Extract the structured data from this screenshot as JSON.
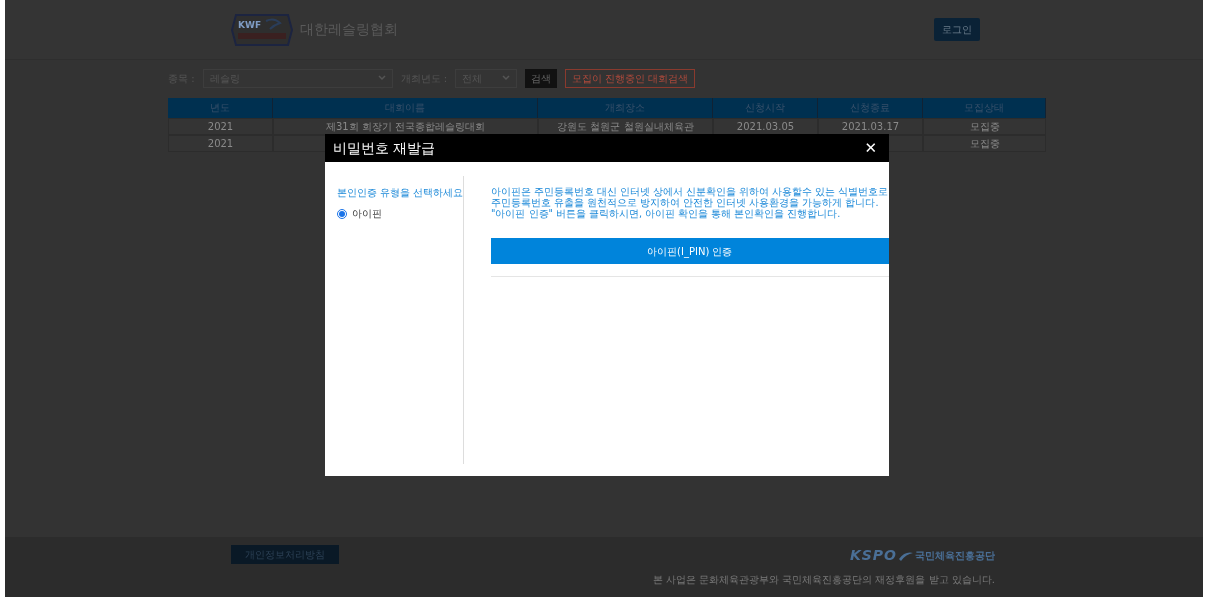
{
  "header": {
    "logo_text": "KWF",
    "site_title": "대한레슬링협회",
    "login_button": "로그인"
  },
  "filters": [
    {
      "label": "종목 :",
      "value": "레슬링",
      "kind": "wide"
    },
    {
      "label": "개최년도 :",
      "value": "전체",
      "kind": "narrow"
    }
  ],
  "search_button": "검색",
  "recruiting_search_button": "모집이 진행중인 대회검색",
  "table": {
    "columns": [
      "년도",
      "대회이름",
      "개최장소",
      "신청시작",
      "신청종료",
      "모집상태"
    ],
    "rows": [
      [
        "2021",
        "제31회 회장기 전국종합레슬링대회",
        "강원도 철원군 철원실내체육관",
        "2021.03.05",
        "2021.03.17",
        "모집중"
      ],
      [
        "2021",
        "",
        "",
        "",
        "",
        "모집중"
      ]
    ]
  },
  "modal": {
    "title": "비밀번호 재발급",
    "close": "✕",
    "prompt": "본인인증 유형을 선택하세요",
    "options": [
      {
        "label": "아이핀",
        "selected": true
      }
    ],
    "description": [
      "아이핀은 주민등록번호 대신 인터넷 상에서 신분확인을 위하여 사용할수 있는 식별번호로",
      "주민등록번호 유출을 원천적으로 방지하여 안전한 인터넷 사용환경을 가능하게 합니다.",
      "\"아이핀 인증\" 버튼을 클릭하시면, 아이핀 확인을 통해 본인확인을 진행합니다."
    ],
    "auth_button": "아이핀(I_PIN) 인증"
  },
  "footer": {
    "privacy_button": "개인정보처리방침",
    "logo_text": "KSPO",
    "logo_name": "국민체육진흥공단",
    "notice": "본 사업은 문화체육관광부와 국민체육진흥공단의 재정후원을 받고 있습니다."
  }
}
